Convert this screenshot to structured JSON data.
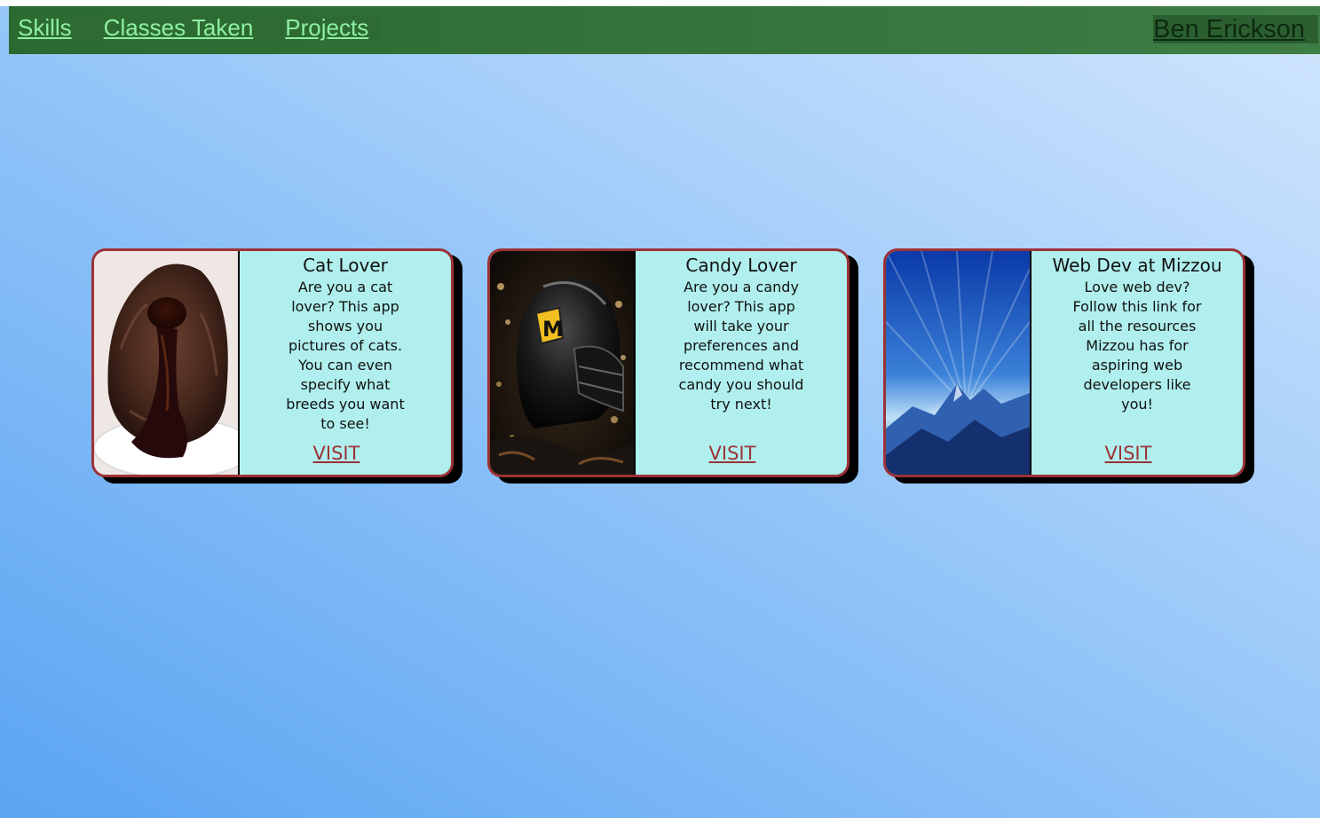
{
  "nav": {
    "links": [
      "Skills",
      "Classes Taken",
      "Projects"
    ],
    "brand": "Ben Erickson",
    "link_color": "#8ef0a0",
    "bar_color": "#2f6c36"
  },
  "cards": [
    {
      "title": "Cat Lover",
      "description": "Are you a cat lover? This app shows you pictures of cats. You can even specify what breeds you want to see!",
      "link": "VISIT",
      "image": "chocolate-lava-cake-image"
    },
    {
      "title": "Candy Lover",
      "description": "Are you a candy lover? This app will take your preferences and recommend what candy you should try next!",
      "link": "VISIT",
      "image": "mizzou-helmet-image"
    },
    {
      "title": "Web Dev at Mizzou",
      "description": "Love web dev? Follow this link for all the resources Mizzou has for aspiring web developers like you!",
      "link": "VISIT",
      "image": "blue-mountain-image"
    }
  ],
  "colors": {
    "card_background": "#b0efed",
    "card_border": "#9c3236",
    "visit_link": "#9c3236"
  }
}
